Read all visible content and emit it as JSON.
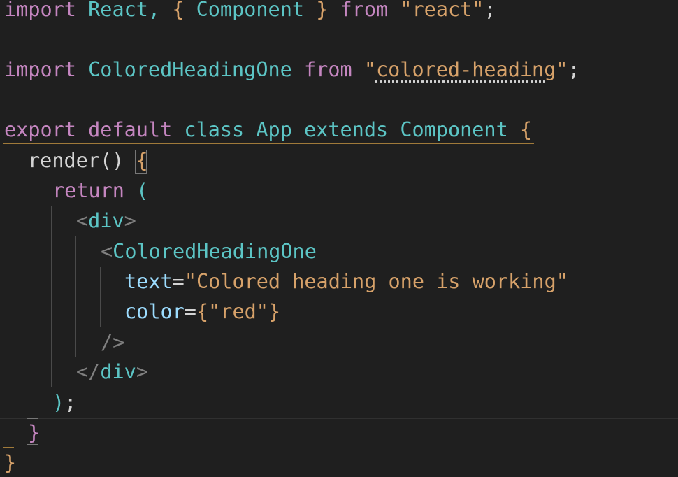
{
  "colors": {
    "background": "#1f1f1f",
    "keyword": "#c586c0",
    "identifier": "#5cc5c5",
    "string": "#d7a26a",
    "brace": "#d7a26a",
    "text": "#d4d4d4",
    "angle_bracket": "#808080",
    "attribute": "#9cdcfe",
    "scope_highlight": "#a07a3a"
  },
  "code": {
    "line1": {
      "import": "import",
      "react": "React,",
      "open": "{",
      "component": "Component",
      "close": "}",
      "from": "from",
      "module": "\"react\"",
      "semi": ";"
    },
    "line3": {
      "import": "import",
      "name": "ColoredHeadingOne",
      "from": "from",
      "quote": "\"",
      "module": "colored-heading",
      "quote_end": "\"",
      "semi": ";"
    },
    "line5": {
      "export": "export",
      "default": "default",
      "class": "class",
      "app": "App",
      "extends": "extends",
      "component": "Component",
      "brace": "{"
    },
    "line6": {
      "render": "render()",
      "brace": "{"
    },
    "line7": {
      "return": "return",
      "paren": "("
    },
    "line8": {
      "lt": "<",
      "tag": "div",
      "gt": ">"
    },
    "line9": {
      "lt": "<",
      "tag": "ColoredHeadingOne"
    },
    "line10": {
      "attr": "text",
      "eq": "=",
      "value": "\"Colored heading one is working\""
    },
    "line11": {
      "attr": "color",
      "eq": "=",
      "open": "{",
      "value": "\"red\"",
      "close": "}"
    },
    "line12": {
      "selfclose": "/>"
    },
    "line13": {
      "lt": "</",
      "tag": "div",
      "gt": ">"
    },
    "line14": {
      "close": ")",
      "semi": ";"
    },
    "line15": {
      "brace": "}"
    },
    "line16": {
      "brace": "}"
    }
  }
}
